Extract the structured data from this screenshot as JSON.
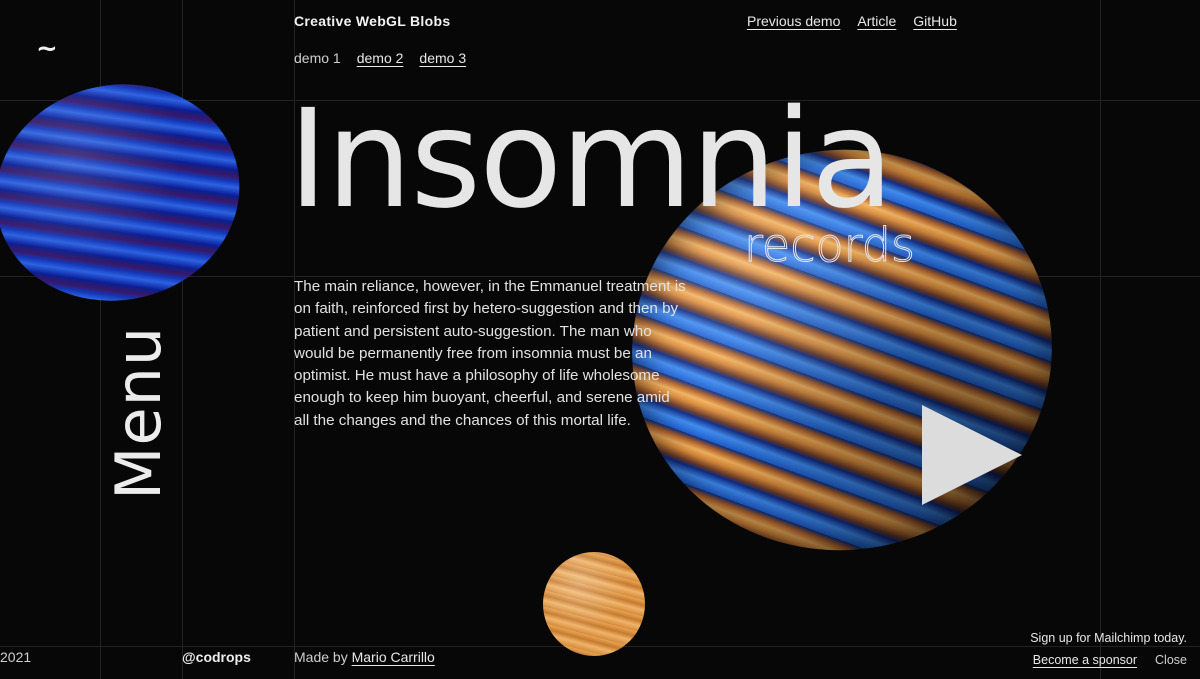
{
  "header": {
    "title": "Creative WebGL Blobs",
    "links": [
      "Previous demo",
      "Article",
      "GitHub"
    ]
  },
  "demos": {
    "current": "demo 1",
    "links": [
      "demo 2",
      "demo 3"
    ]
  },
  "nav": {
    "menu_label": "Menu",
    "logo_glyph": "~"
  },
  "hero": {
    "title": "Insomnia",
    "subtitle": "records",
    "body": "The main reliance, however, in the Emmanuel treatment is on faith, reinforced first by hetero-suggestion and then by patient and persistent auto-suggestion. The man who would be permanently free from insomnia must be an optimist. He must have a philosophy of life wholesome enough to keep him buoyant, cheerful, and serene amid all the changes and the chances of this mortal life."
  },
  "icons": {
    "play": "play-icon"
  },
  "footer": {
    "year": "2021",
    "handle": "@codrops",
    "made_by_prefix": "Made by",
    "author": "Mario Carrillo"
  },
  "ad": {
    "text": "Sign up for Mailchimp today.",
    "sponsor_link": "Become a sponsor",
    "close": "Close"
  }
}
